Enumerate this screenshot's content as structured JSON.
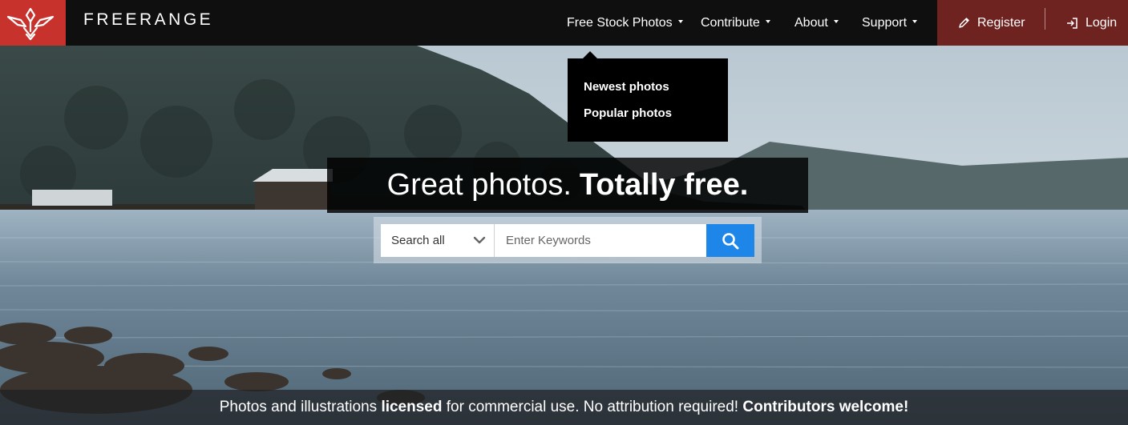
{
  "brand": {
    "name": "FREERANGE",
    "logo_icon": "winged-bird-logo-icon",
    "logo_color": "#c8322c"
  },
  "nav": {
    "items": [
      {
        "label": "Free Stock Photos",
        "has_dropdown": true
      },
      {
        "label": "Contribute",
        "has_dropdown": true
      },
      {
        "label": "About",
        "has_dropdown": true
      },
      {
        "label": "Support",
        "has_dropdown": true
      }
    ],
    "register": {
      "label": "Register",
      "icon": "pencil-icon"
    },
    "login": {
      "label": "Login",
      "icon": "login-icon"
    },
    "auth_bg": "#6e2320"
  },
  "dropdown": {
    "items": [
      "Newest photos",
      "Popular photos"
    ]
  },
  "hero": {
    "headline_light": "Great photos.",
    "headline_bold": "Totally free."
  },
  "search": {
    "category": "Search all",
    "placeholder": "Enter Keywords",
    "button_icon": "search-icon",
    "button_color": "#1e86e8"
  },
  "tagline": {
    "part1": "Photos and illustrations ",
    "bold1": "licensed",
    "part2": " for commercial use. No attribution required! ",
    "bold2": "Contributors welcome!"
  }
}
